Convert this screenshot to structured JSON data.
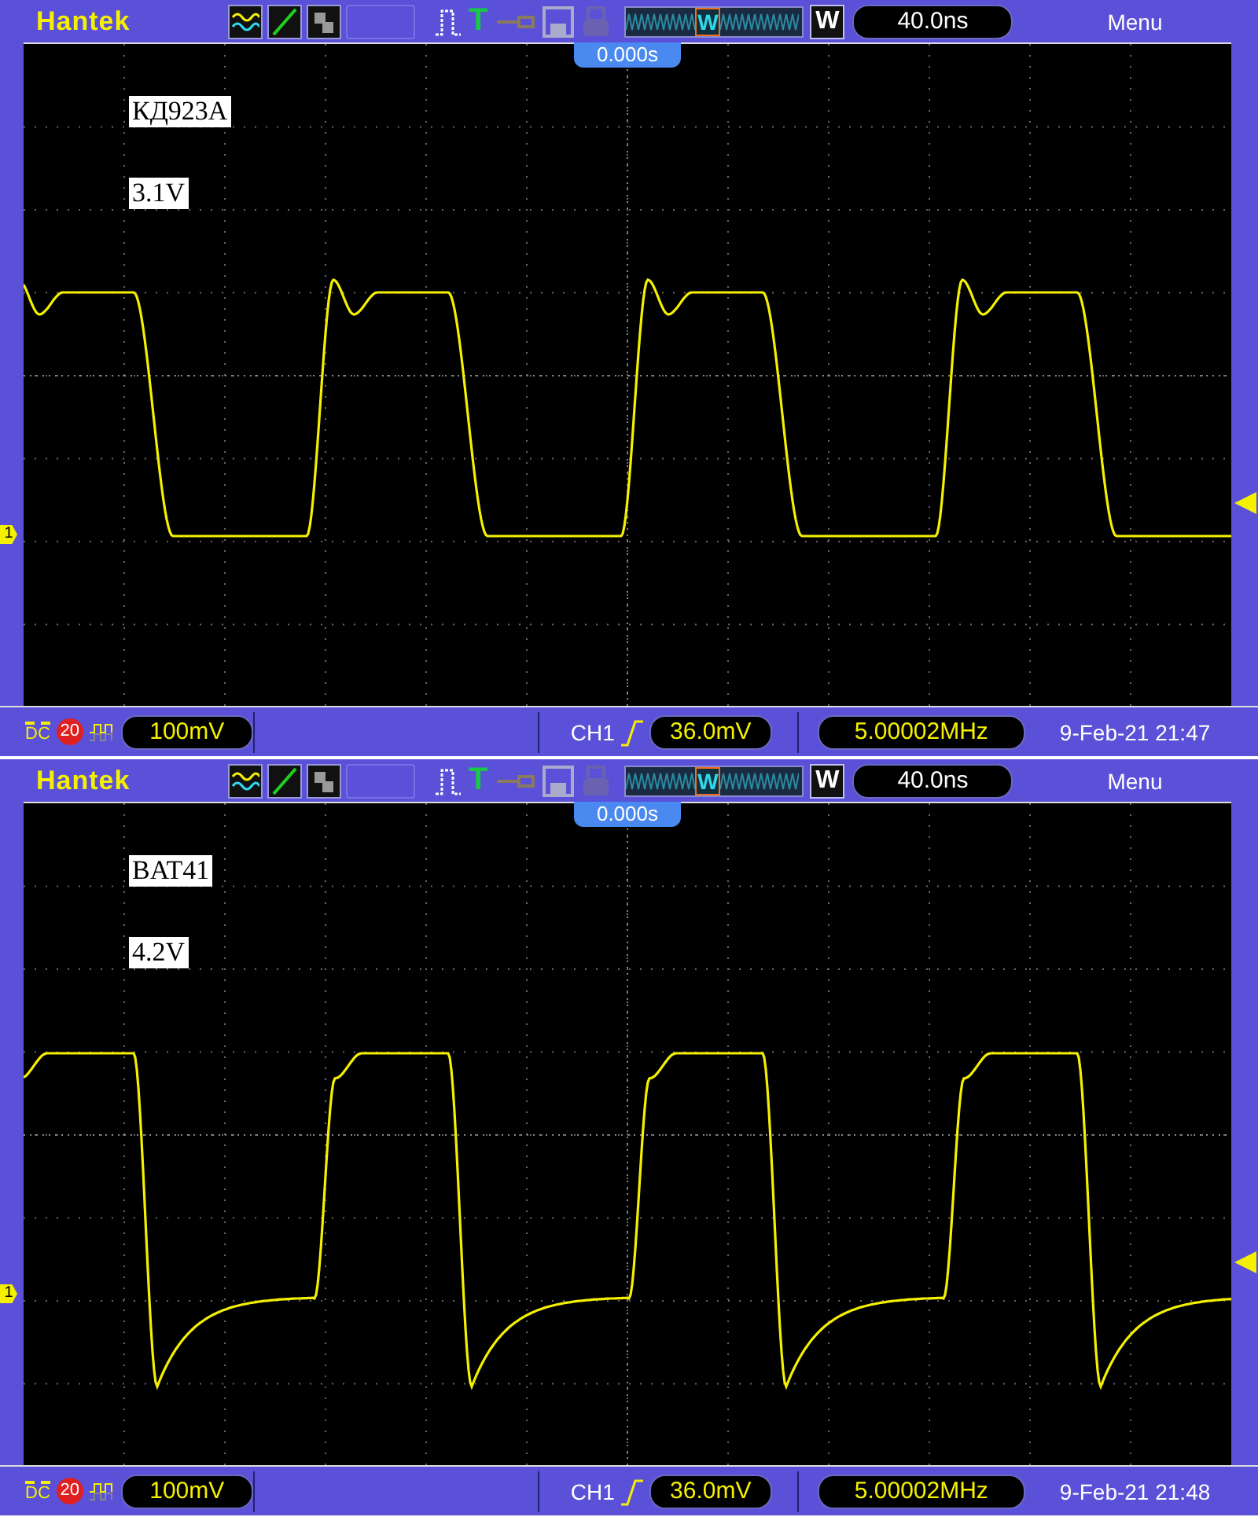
{
  "panels": [
    {
      "brand": "Hantek",
      "trigger_mark": "T",
      "window_mark": "W",
      "zoom_key": "W",
      "timebase": "40.0ns",
      "menu": "Menu",
      "trigger_position": "0.000s",
      "labels": [
        "КД923А",
        "3.1V"
      ],
      "channel_marker": "1",
      "coupling": "DC",
      "bandwidth_limit": "20",
      "volts_per_div": "100mV",
      "trigger_source": "CH1",
      "trigger_level": "36.0mV",
      "frequency": "5.00002MHz",
      "datetime": "9-Feb-21 21:47",
      "trace": {
        "kind": "ringing"
      }
    },
    {
      "brand": "Hantek",
      "trigger_mark": "T",
      "window_mark": "W",
      "zoom_key": "W",
      "timebase": "40.0ns",
      "menu": "Menu",
      "trigger_position": "0.000s",
      "labels": [
        "BAT41",
        "4.2V"
      ],
      "channel_marker": "1",
      "coupling": "DC",
      "bandwidth_limit": "20",
      "volts_per_div": "100mV",
      "trigger_source": "CH1",
      "trigger_level": "36.0mV",
      "frequency": "5.00002MHz",
      "datetime": "9-Feb-21 21:48",
      "trace": {
        "kind": "recovery"
      }
    }
  ]
}
